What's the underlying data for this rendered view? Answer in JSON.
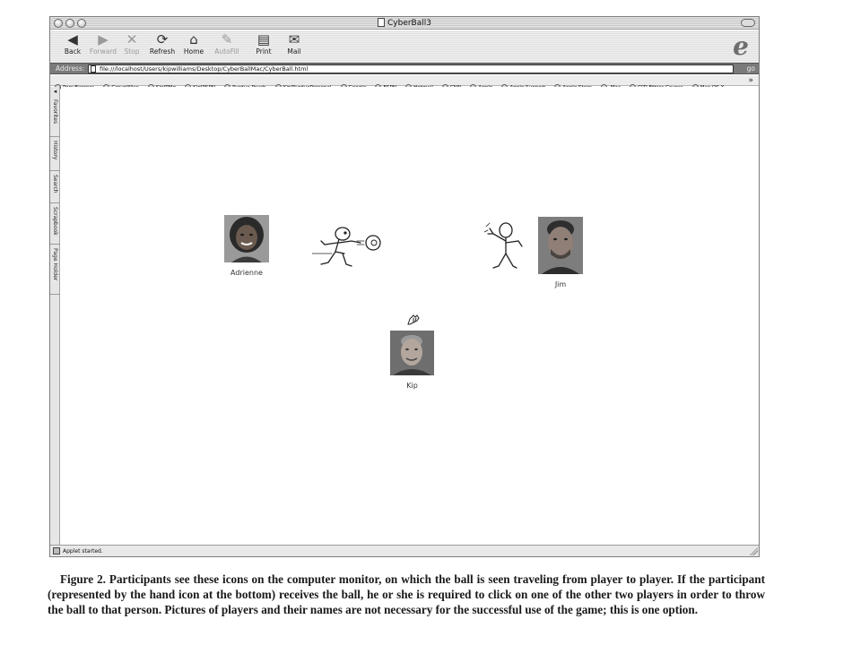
{
  "window": {
    "title": "CyberBall3"
  },
  "toolbar": {
    "buttons": [
      {
        "label": "Back",
        "icon": "back-arrow-icon",
        "enabled": true
      },
      {
        "label": "Forward",
        "icon": "forward-arrow-icon",
        "enabled": false
      },
      {
        "label": "Stop",
        "icon": "stop-icon",
        "enabled": false
      },
      {
        "label": "Refresh",
        "icon": "refresh-icon",
        "enabled": true
      },
      {
        "label": "Home",
        "icon": "home-icon",
        "enabled": true
      },
      {
        "label": "AutoFill",
        "icon": "autofill-icon",
        "enabled": false
      },
      {
        "label": "Print",
        "icon": "printer-icon",
        "enabled": true
      },
      {
        "label": "Mail",
        "icon": "mail-icon",
        "enabled": true
      }
    ]
  },
  "address": {
    "label": "Address:",
    "url": "file:///localhost/Users/kipwilliams/Desktop/CyberBallMac/CyberBall.html",
    "go_label": "go"
  },
  "favorites": [
    "PonyExpress",
    "GroupWise",
    "KipIPMq",
    "KipIPSPN",
    "Purdue Psych",
    "KipIPurduePersonal",
    "Google",
    "ESPN",
    "Hotmail",
    "CNN",
    "Apple",
    "Apple Support",
    "Apple Store",
    ".Mac",
    "CITI Ethics Course",
    "Mac OS X"
  ],
  "favorites_more": "»",
  "sidebar_tabs": [
    "Favorites",
    "History",
    "Search",
    "Scrapbook",
    "Page Holder"
  ],
  "game": {
    "players": [
      {
        "name": "Adrienne"
      },
      {
        "name": "Jim"
      },
      {
        "name": "Kip"
      }
    ]
  },
  "status": {
    "text": "Applet started."
  },
  "caption": "Figure 2. Participants see these icons on the computer monitor, on which the ball is seen traveling from player to player. If the participant (represented by the hand icon at the bottom) receives the ball, he or she is required to click on one of the other two players in order to throw the ball to that person. Pictures of players and their names are not necessary for the successful use of the game; this is one option."
}
